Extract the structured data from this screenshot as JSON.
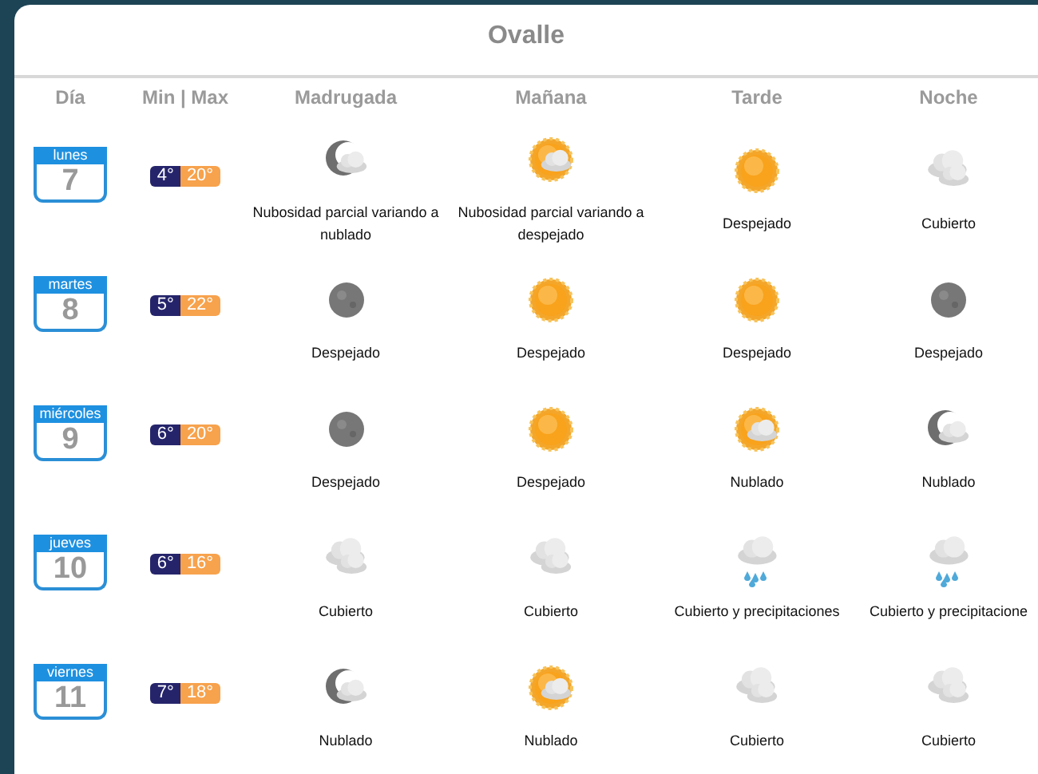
{
  "title": "Ovalle",
  "columns": [
    "Día",
    "Min | Max",
    "Madrugada",
    "Mañana",
    "Tarde",
    "Noche"
  ],
  "days": [
    {
      "weekday": "lunes",
      "day": "7",
      "min": "4°",
      "max": "20°",
      "periods": [
        {
          "kind": "moon-cloud",
          "text": "Nubosidad parcial variando a nublado"
        },
        {
          "kind": "sun-cloud",
          "text": "Nubosidad parcial variando a despejado"
        },
        {
          "kind": "sun",
          "text": "Despejado"
        },
        {
          "kind": "cloud",
          "text": "Cubierto"
        }
      ]
    },
    {
      "weekday": "martes",
      "day": "8",
      "min": "5°",
      "max": "22°",
      "periods": [
        {
          "kind": "moon",
          "text": "Despejado"
        },
        {
          "kind": "sun",
          "text": "Despejado"
        },
        {
          "kind": "sun",
          "text": "Despejado"
        },
        {
          "kind": "moon",
          "text": "Despejado"
        }
      ]
    },
    {
      "weekday": "miércoles",
      "day": "9",
      "min": "6°",
      "max": "20°",
      "periods": [
        {
          "kind": "moon",
          "text": "Despejado"
        },
        {
          "kind": "sun",
          "text": "Despejado"
        },
        {
          "kind": "sun-cloud",
          "text": "Nublado"
        },
        {
          "kind": "moon-cloud",
          "text": "Nublado"
        }
      ]
    },
    {
      "weekday": "jueves",
      "day": "10",
      "min": "6°",
      "max": "16°",
      "periods": [
        {
          "kind": "cloud",
          "text": "Cubierto"
        },
        {
          "kind": "cloud",
          "text": "Cubierto"
        },
        {
          "kind": "rain",
          "text": "Cubierto y precipitaciones"
        },
        {
          "kind": "rain",
          "text": "Cubierto y precipitacione"
        }
      ]
    },
    {
      "weekday": "viernes",
      "day": "11",
      "min": "7°",
      "max": "18°",
      "periods": [
        {
          "kind": "moon-cloud",
          "text": "Nublado"
        },
        {
          "kind": "sun-cloud",
          "text": "Nublado"
        },
        {
          "kind": "cloud",
          "text": "Cubierto"
        },
        {
          "kind": "cloud",
          "text": "Cubierto"
        }
      ]
    }
  ]
}
